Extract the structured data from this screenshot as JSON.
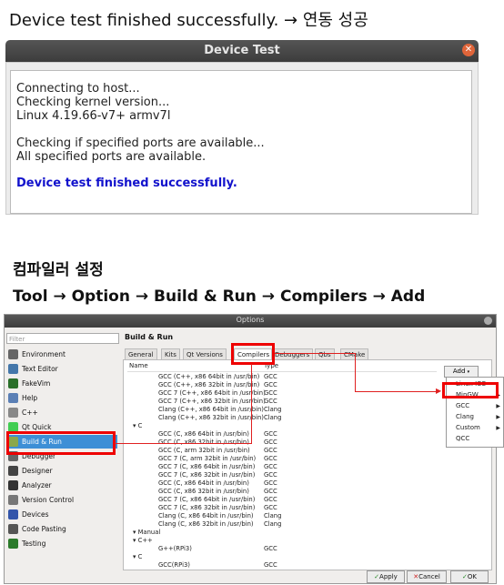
{
  "top_note": "Device test finished successfully. → 연동 성공",
  "device_test": {
    "title": "Device Test",
    "close_glyph": "✕",
    "log": [
      "Connecting to host...",
      "Checking kernel version...",
      "Linux 4.19.66-v7+ armv7l",
      "",
      "Checking if specified ports are available...",
      "All specified ports are available.",
      "",
      "Device test finished successfully."
    ]
  },
  "heading_compiler": "컴파일러 설정",
  "heading_path": "Tool → Option → Build & Run → Compilers → Add",
  "options": {
    "title": "Options",
    "filter_placeholder": "Filter",
    "page_title": "Build & Run",
    "sidebar": [
      {
        "label": "Environment",
        "icon": "environment-icon",
        "color": "#666666"
      },
      {
        "label": "Text Editor",
        "icon": "text-editor-icon",
        "color": "#4477aa"
      },
      {
        "label": "FakeVim",
        "icon": "fakevim-icon",
        "color": "#2a6f2a"
      },
      {
        "label": "Help",
        "icon": "help-icon",
        "color": "#5a7fb5"
      },
      {
        "label": "C++",
        "icon": "cpp-icon",
        "color": "#888888"
      },
      {
        "label": "Qt Quick",
        "icon": "qt-quick-icon",
        "color": "#41cd52"
      },
      {
        "label": "Build & Run",
        "icon": "build-run-icon",
        "color": "#8aa84c"
      },
      {
        "label": "Debugger",
        "icon": "debugger-icon",
        "color": "#666666"
      },
      {
        "label": "Designer",
        "icon": "designer-icon",
        "color": "#444444"
      },
      {
        "label": "Analyzer",
        "icon": "analyzer-icon",
        "color": "#333333"
      },
      {
        "label": "Version Control",
        "icon": "version-control-icon",
        "color": "#777777"
      },
      {
        "label": "Devices",
        "icon": "devices-icon",
        "color": "#3355aa"
      },
      {
        "label": "Code Pasting",
        "icon": "code-pasting-icon",
        "color": "#555555"
      },
      {
        "label": "Testing",
        "icon": "testing-icon",
        "color": "#2b7a2b"
      }
    ],
    "tabs": [
      "General",
      "Kits",
      "Qt Versions",
      "Compilers",
      "Debuggers",
      "Qbs",
      "CMake"
    ],
    "tree_headers": {
      "name": "Name",
      "type": "Type"
    },
    "tree": [
      {
        "name": "GCC (C++, x86 64bit in /usr/bin)",
        "type": "GCC"
      },
      {
        "name": "GCC (C++, x86 32bit in /usr/bin)",
        "type": "GCC"
      },
      {
        "name": "GCC 7 (C++, x86 64bit in /usr/bin)",
        "type": "GCC"
      },
      {
        "name": "GCC 7 (C++, x86 32bit in /usr/bin)",
        "type": "GCC"
      },
      {
        "name": "Clang (C++, x86 64bit in /usr/bin)",
        "type": "Clang"
      },
      {
        "name": "Clang (C++, x86 32bit in /usr/bin)",
        "type": "Clang"
      },
      {
        "name": "▾ C",
        "type": "",
        "group": true
      },
      {
        "name": "GCC (C, x86 64bit in /usr/bin)",
        "type": "GCC"
      },
      {
        "name": "GCC (C, x86 32bit in /usr/bin)",
        "type": "GCC"
      },
      {
        "name": "GCC (C, arm 32bit in /usr/bin)",
        "type": "GCC"
      },
      {
        "name": "GCC 7 (C, arm 32bit in /usr/bin)",
        "type": "GCC"
      },
      {
        "name": "GCC 7 (C, x86 64bit in /usr/bin)",
        "type": "GCC"
      },
      {
        "name": "GCC 7 (C, x86 32bit in /usr/bin)",
        "type": "GCC"
      },
      {
        "name": "GCC (C, x86 64bit in /usr/bin)",
        "type": "GCC"
      },
      {
        "name": "GCC (C, x86 32bit in /usr/bin)",
        "type": "GCC"
      },
      {
        "name": "GCC 7 (C, x86 64bit in /usr/bin)",
        "type": "GCC"
      },
      {
        "name": "GCC 7 (C, x86 32bit in /usr/bin)",
        "type": "GCC"
      },
      {
        "name": "Clang (C, x86 64bit in /usr/bin)",
        "type": "Clang"
      },
      {
        "name": "Clang (C, x86 32bit in /usr/bin)",
        "type": "Clang"
      },
      {
        "name": "▾ Manual",
        "type": "",
        "group": true
      },
      {
        "name": "▾ C++",
        "type": "",
        "group": true
      },
      {
        "name": "G++(RPi3)",
        "type": "GCC"
      },
      {
        "name": "▾ C",
        "type": "",
        "group": true
      },
      {
        "name": "GCC(RPi3)",
        "type": "GCC"
      }
    ],
    "add_label": "Add",
    "add_menu": [
      {
        "label": "Linux ICC",
        "submenu": false
      },
      {
        "label": "MinGW",
        "submenu": true
      },
      {
        "label": "GCC",
        "submenu": true
      },
      {
        "label": "Clang",
        "submenu": true
      },
      {
        "label": "Custom",
        "submenu": true
      },
      {
        "label": "QCC",
        "submenu": false
      }
    ],
    "buttons": {
      "apply": "Apply",
      "cancel": "Cancel",
      "ok": "OK"
    }
  },
  "colors": {
    "highlight": "#e00000",
    "selection": "#3d8fd6"
  }
}
